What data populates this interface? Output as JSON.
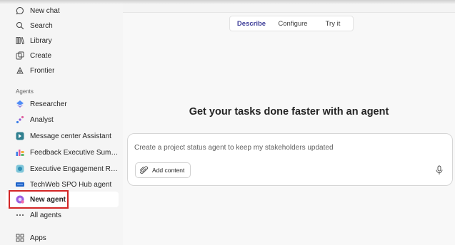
{
  "sidebar": {
    "top_items": [
      {
        "label": "New chat",
        "icon": "chat-bubble-icon"
      },
      {
        "label": "Search",
        "icon": "search-icon"
      },
      {
        "label": "Library",
        "icon": "library-icon"
      },
      {
        "label": "Create",
        "icon": "create-icon"
      },
      {
        "label": "Frontier",
        "icon": "frontier-icon"
      }
    ],
    "section_label": "Agents",
    "agents": [
      {
        "label": "Researcher",
        "icon": "researcher-icon"
      },
      {
        "label": "Analyst",
        "icon": "analyst-icon"
      },
      {
        "label": "Message center Assistant",
        "icon": "message-center-icon"
      },
      {
        "label": "Feedback Executive Summary",
        "icon": "feedback-icon"
      },
      {
        "label": "Executive Engagement Report...",
        "icon": "engagement-icon"
      },
      {
        "label": "TechWeb SPO Hub agent",
        "icon": "techweb-icon"
      },
      {
        "label": "New agent",
        "icon": "new-agent-icon"
      }
    ],
    "all_agents_label": "All agents",
    "apps_label": "Apps"
  },
  "tabs": [
    {
      "label": "Describe",
      "active": true
    },
    {
      "label": "Configure",
      "active": false
    },
    {
      "label": "Try it",
      "active": false
    }
  ],
  "main": {
    "headline": "Get your tasks done faster with an agent",
    "composer_placeholder": "Create a project status agent to keep my stakeholders updated",
    "add_content_label": "Add content"
  },
  "colors": {
    "accent": "#5b5fc7",
    "highlight_box": "#d32626"
  }
}
